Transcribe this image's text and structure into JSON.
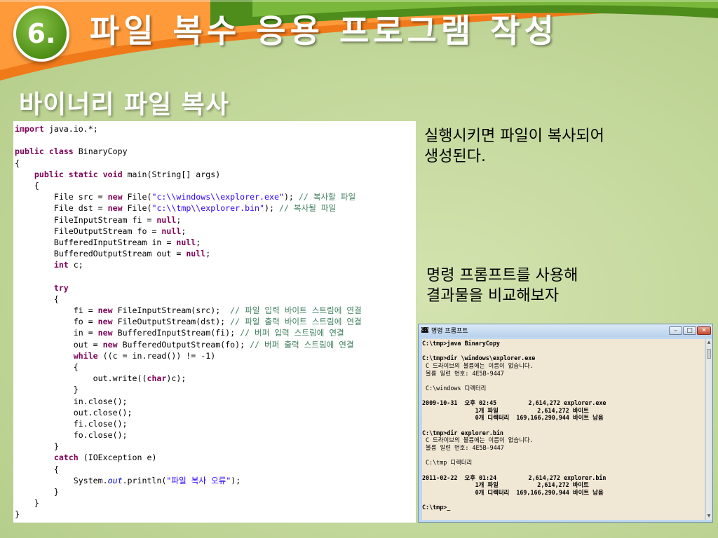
{
  "header": {
    "number": "6.",
    "title": "파일 복수 응용 프로그램 작성",
    "subtitle": "바이너리 파일 복사"
  },
  "colors": {
    "orange_swoosh": "#f07a1a",
    "green_swoosh": "#5f9d2a",
    "keyword": "#7f0055",
    "string": "#2a00ff",
    "comment": "#3f7f5f"
  },
  "code_lines": [
    [
      {
        "t": "import",
        "c": "kw"
      },
      {
        "t": " java.io.*;"
      }
    ],
    [],
    [
      {
        "t": "public",
        "c": "kw"
      },
      {
        "t": " "
      },
      {
        "t": "class",
        "c": "kw"
      },
      {
        "t": " BinaryCopy"
      }
    ],
    [
      {
        "t": "{"
      }
    ],
    [
      {
        "t": "    "
      },
      {
        "t": "public",
        "c": "kw"
      },
      {
        "t": " "
      },
      {
        "t": "static",
        "c": "kw"
      },
      {
        "t": " "
      },
      {
        "t": "void",
        "c": "kw"
      },
      {
        "t": " main(String[] args)"
      }
    ],
    [
      {
        "t": "    {"
      }
    ],
    [
      {
        "t": "        File src = "
      },
      {
        "t": "new",
        "c": "kw"
      },
      {
        "t": " File("
      },
      {
        "t": "\"c:\\\\windows\\\\explorer.exe\"",
        "c": "str"
      },
      {
        "t": "); "
      },
      {
        "t": "// 복사할 파일",
        "c": "cm"
      }
    ],
    [
      {
        "t": "        File dst = "
      },
      {
        "t": "new",
        "c": "kw"
      },
      {
        "t": " File("
      },
      {
        "t": "\"c:\\\\tmp\\\\explorer.bin\"",
        "c": "str"
      },
      {
        "t": "); "
      },
      {
        "t": "// 복사될 파일",
        "c": "cm"
      }
    ],
    [
      {
        "t": "        FileInputStream fi = "
      },
      {
        "t": "null",
        "c": "kw"
      },
      {
        "t": ";"
      }
    ],
    [
      {
        "t": "        FileOutputStream fo = "
      },
      {
        "t": "null",
        "c": "kw"
      },
      {
        "t": ";"
      }
    ],
    [
      {
        "t": "        BufferedInputStream in = "
      },
      {
        "t": "null",
        "c": "kw"
      },
      {
        "t": ";"
      }
    ],
    [
      {
        "t": "        BufferedOutputStream out = "
      },
      {
        "t": "null",
        "c": "kw"
      },
      {
        "t": ";"
      }
    ],
    [
      {
        "t": "        "
      },
      {
        "t": "int",
        "c": "kw"
      },
      {
        "t": " c;"
      }
    ],
    [],
    [
      {
        "t": "        "
      },
      {
        "t": "try",
        "c": "kw"
      }
    ],
    [
      {
        "t": "        {"
      }
    ],
    [
      {
        "t": "            fi = "
      },
      {
        "t": "new",
        "c": "kw"
      },
      {
        "t": " FileInputStream(src);  "
      },
      {
        "t": "// 파일 입력 바이트 스트림에 연결",
        "c": "cm"
      }
    ],
    [
      {
        "t": "            fo = "
      },
      {
        "t": "new",
        "c": "kw"
      },
      {
        "t": " FileOutputStream(dst); "
      },
      {
        "t": "// 파일 출력 바이트 스트림에 연결",
        "c": "cm"
      }
    ],
    [
      {
        "t": "            in = "
      },
      {
        "t": "new",
        "c": "kw"
      },
      {
        "t": " BufferedInputStream(fi); "
      },
      {
        "t": "// 버퍼 입력 스트림에 연결",
        "c": "cm"
      }
    ],
    [
      {
        "t": "            out = "
      },
      {
        "t": "new",
        "c": "kw"
      },
      {
        "t": " BufferedOutputStream(fo); "
      },
      {
        "t": "// 버퍼 출력 스트림에 연결",
        "c": "cm"
      }
    ],
    [
      {
        "t": "            "
      },
      {
        "t": "while",
        "c": "kw"
      },
      {
        "t": " ((c = in.read()) != -1)"
      }
    ],
    [
      {
        "t": "            {"
      }
    ],
    [
      {
        "t": "                out.write(("
      },
      {
        "t": "char",
        "c": "kw"
      },
      {
        "t": ")c);"
      }
    ],
    [
      {
        "t": "            }"
      }
    ],
    [
      {
        "t": "            in.close();"
      }
    ],
    [
      {
        "t": "            out.close();"
      }
    ],
    [
      {
        "t": "            fi.close();"
      }
    ],
    [
      {
        "t": "            fo.close();"
      }
    ],
    [
      {
        "t": "        }"
      }
    ],
    [
      {
        "t": "        "
      },
      {
        "t": "catch",
        "c": "kw"
      },
      {
        "t": " (IOException e)"
      }
    ],
    [
      {
        "t": "        {"
      }
    ],
    [
      {
        "t": "            System."
      },
      {
        "t": "out",
        "c": "it"
      },
      {
        "t": ".println("
      },
      {
        "t": "\"파일 복사 오류\"",
        "c": "str"
      },
      {
        "t": ");"
      }
    ],
    [
      {
        "t": "        }"
      }
    ],
    [
      {
        "t": "    }"
      }
    ],
    [
      {
        "t": "}"
      }
    ]
  ],
  "notes": {
    "note1_line1": "실행시키면 파일이 복사되어",
    "note1_line2": "생성된다.",
    "note2_line1": "명령 프롬프트를 사용해",
    "note2_line2": "결과물을 비교해보자"
  },
  "cmd_window": {
    "title": "명령 프롬프트",
    "icon_label": "C:\\",
    "lines": [
      "C:\\tmp>java BinaryCopy",
      "",
      "C:\\tmp>dir \\windows\\explorer.exe",
      " C 드라이브의 볼륨에는 이름이 없습니다.",
      " 볼륨 일련 번호: 4E5B-9447",
      "",
      " C:\\windows 디렉터리",
      "",
      "2009-10-31  오후 02:45         2,614,272 explorer.exe",
      "               1개 파일           2,614,272 바이트",
      "               0개 디렉터리  169,166,290,944 바이트 남음",
      "",
      "C:\\tmp>dir explorer.bin",
      " C 드라이브의 볼륨에는 이름이 없습니다.",
      " 볼륨 일련 번호: 4E5B-9447",
      "",
      " C:\\tmp 디렉터리",
      "",
      "2011-02-22  오후 01:24         2,614,272 explorer.bin",
      "               1개 파일           2,614,272 바이트",
      "               0개 디렉터리  169,166,290,944 바이트 남음",
      "",
      "C:\\tmp>_"
    ]
  }
}
